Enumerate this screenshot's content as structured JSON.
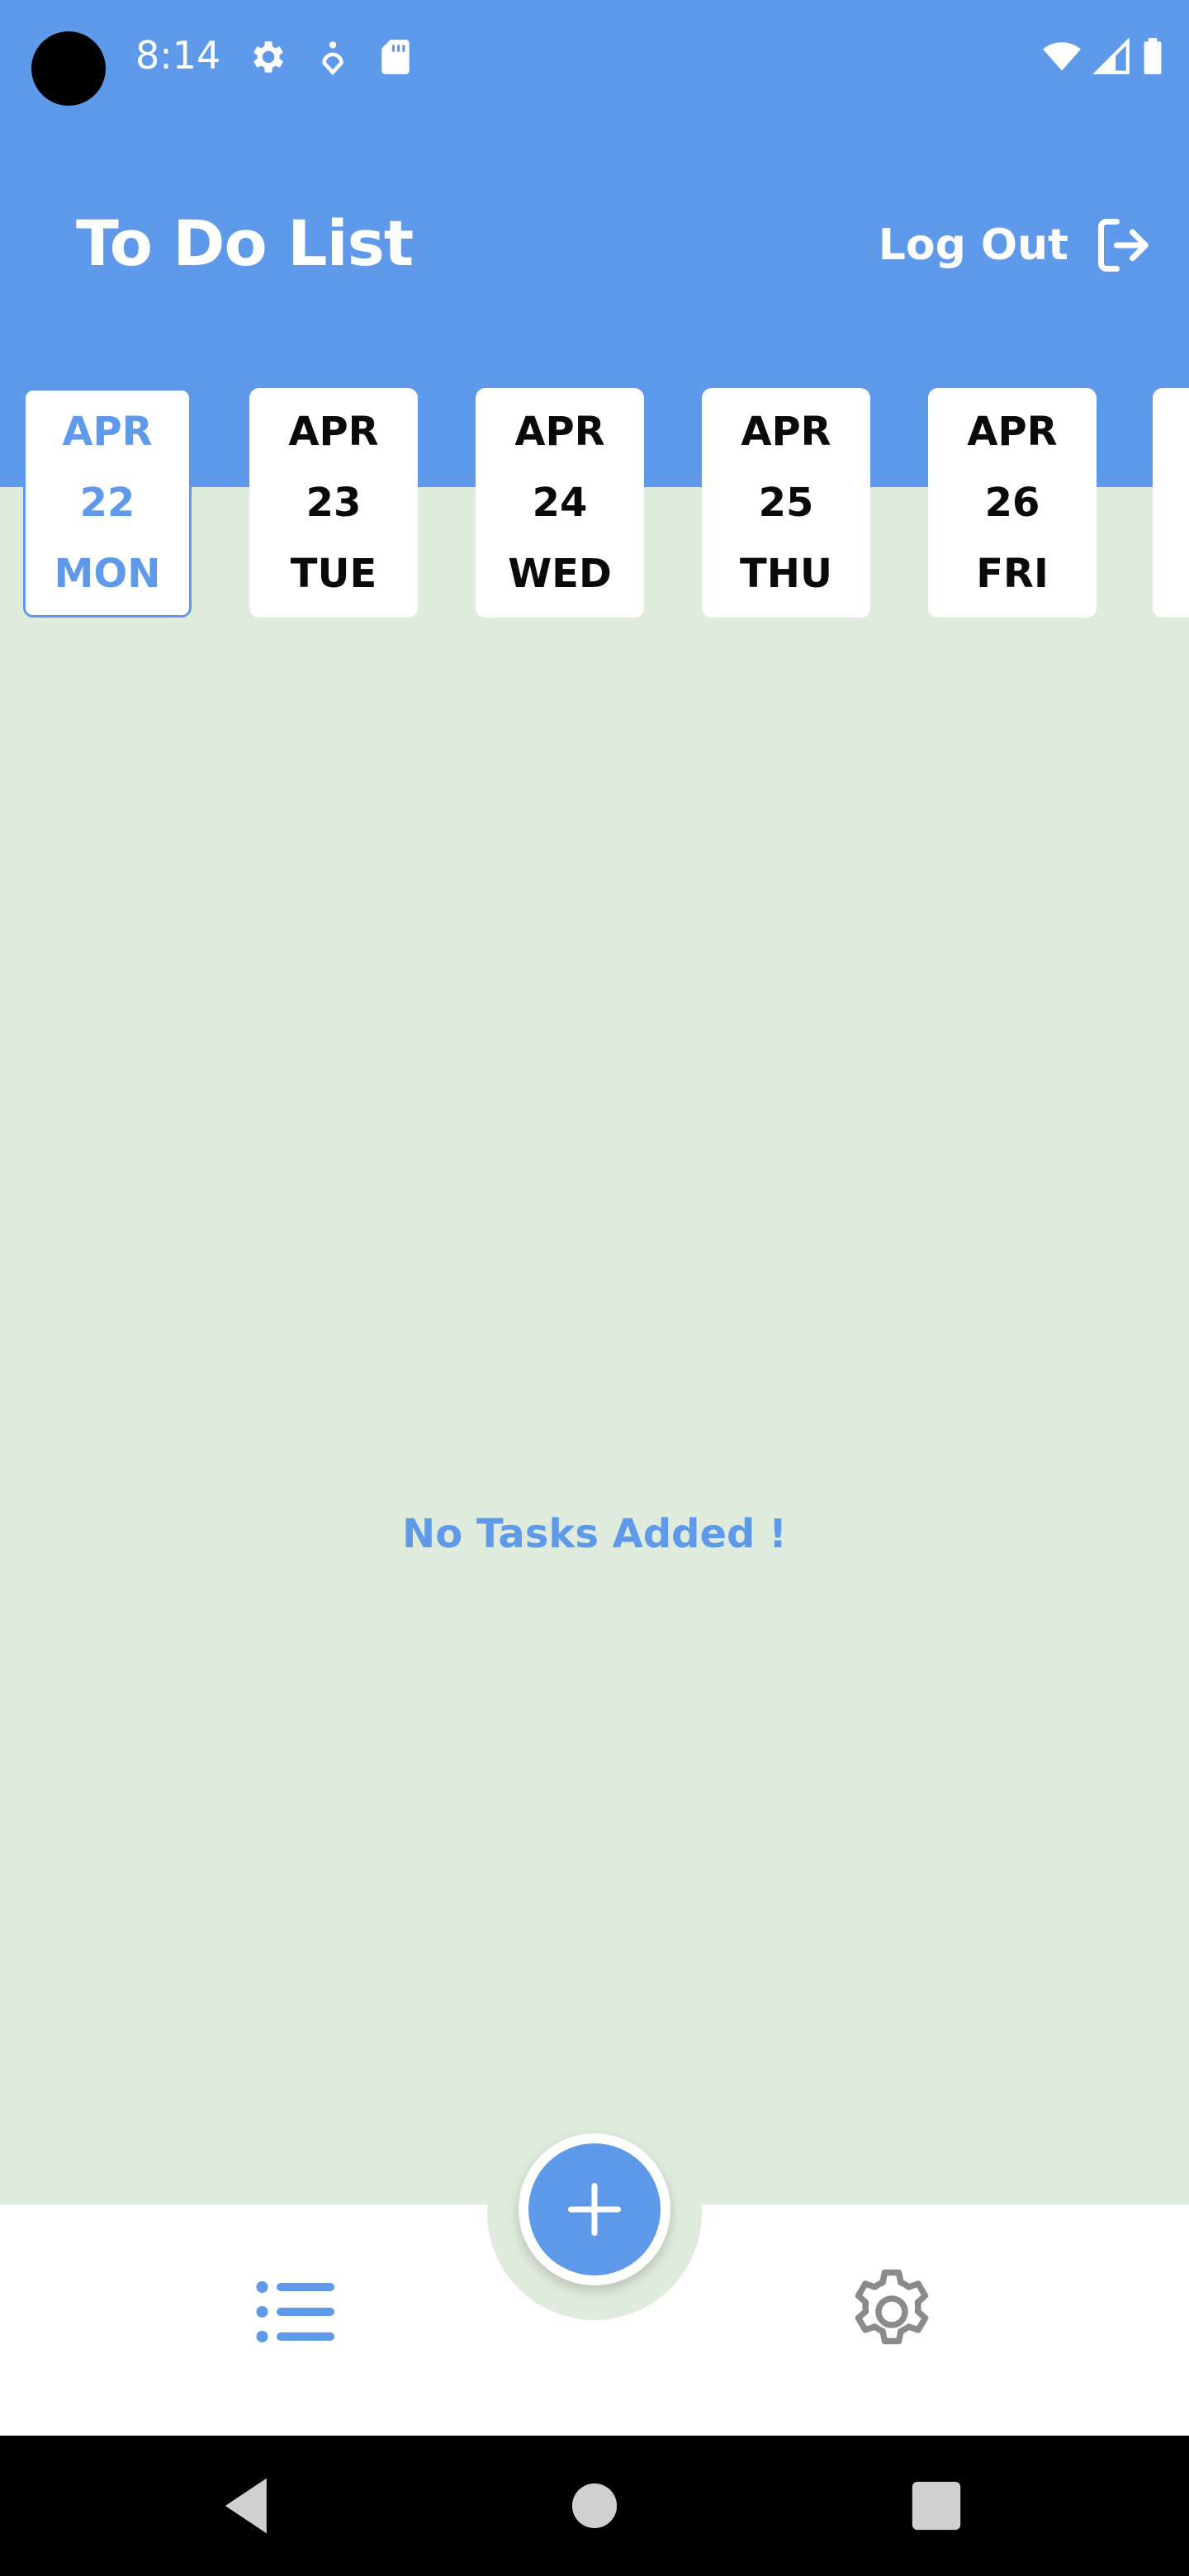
{
  "status_bar": {
    "time": "8:14",
    "icons": [
      "settings-icon",
      "location-icon",
      "sd-card-icon",
      "wifi-icon",
      "signal-icon",
      "battery-icon"
    ]
  },
  "header": {
    "title": "To Do List",
    "logout_label": "Log Out",
    "background_color": "#5F9AEA"
  },
  "date_strip": {
    "dates": [
      {
        "month": "APR",
        "day": "22",
        "weekday": "MON",
        "selected": true
      },
      {
        "month": "APR",
        "day": "23",
        "weekday": "TUE",
        "selected": false
      },
      {
        "month": "APR",
        "day": "24",
        "weekday": "WED",
        "selected": false
      },
      {
        "month": "APR",
        "day": "25",
        "weekday": "THU",
        "selected": false
      },
      {
        "month": "APR",
        "day": "26",
        "weekday": "FRI",
        "selected": false
      }
    ]
  },
  "main": {
    "empty_message": "No Tasks Added !",
    "background_color": "#DFEBDC"
  },
  "bottom_nav": {
    "items": [
      "task-list-icon",
      "settings-icon"
    ],
    "fab_icon": "plus-icon",
    "accent_color": "#5F9AEA"
  },
  "system_nav": {
    "buttons": [
      "back",
      "home",
      "recents"
    ]
  }
}
